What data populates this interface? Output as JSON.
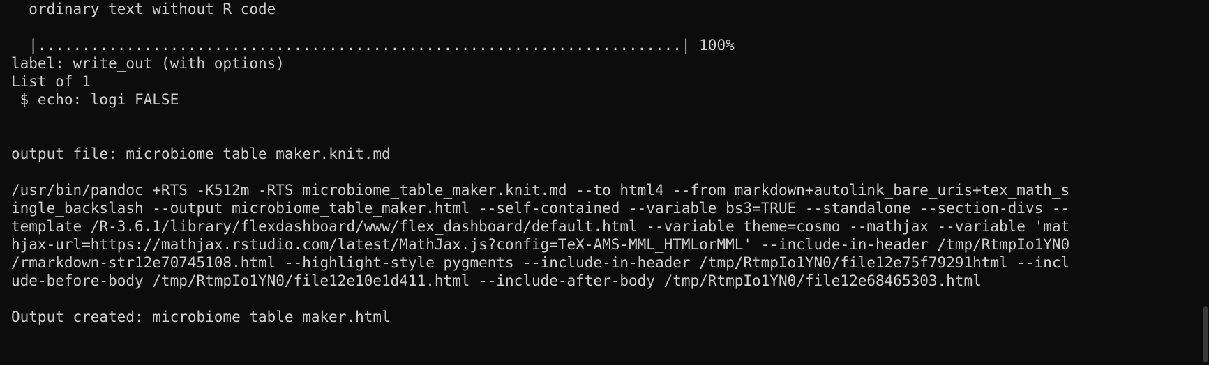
{
  "terminal": {
    "lines": [
      "  ordinary text without R code",
      "",
      "  |.........................................................................| 100%",
      "label: write_out (with options)",
      "List of 1",
      " $ echo: logi FALSE",
      "",
      "",
      "output file: microbiome_table_maker.knit.md",
      "",
      "/usr/bin/pandoc +RTS -K512m -RTS microbiome_table_maker.knit.md --to html4 --from markdown+autolink_bare_uris+tex_math_s",
      "ingle_backslash --output microbiome_table_maker.html --self-contained --variable bs3=TRUE --standalone --section-divs --",
      "template /R-3.6.1/library/flexdashboard/www/flex_dashboard/default.html --variable theme=cosmo --mathjax --variable 'mat",
      "hjax-url=https://mathjax.rstudio.com/latest/MathJax.js?config=TeX-AMS-MML_HTMLorMML' --include-in-header /tmp/RtmpIo1YN0",
      "/rmarkdown-str12e70745108.html --highlight-style pygments --include-in-header /tmp/RtmpIo1YN0/file12e75f79291html --incl",
      "ude-before-body /tmp/RtmpIo1YN0/file12e10e1d411.html --include-after-body /tmp/RtmpIo1YN0/file12e68465303.html",
      "",
      "Output created: microbiome_table_maker.html"
    ]
  }
}
